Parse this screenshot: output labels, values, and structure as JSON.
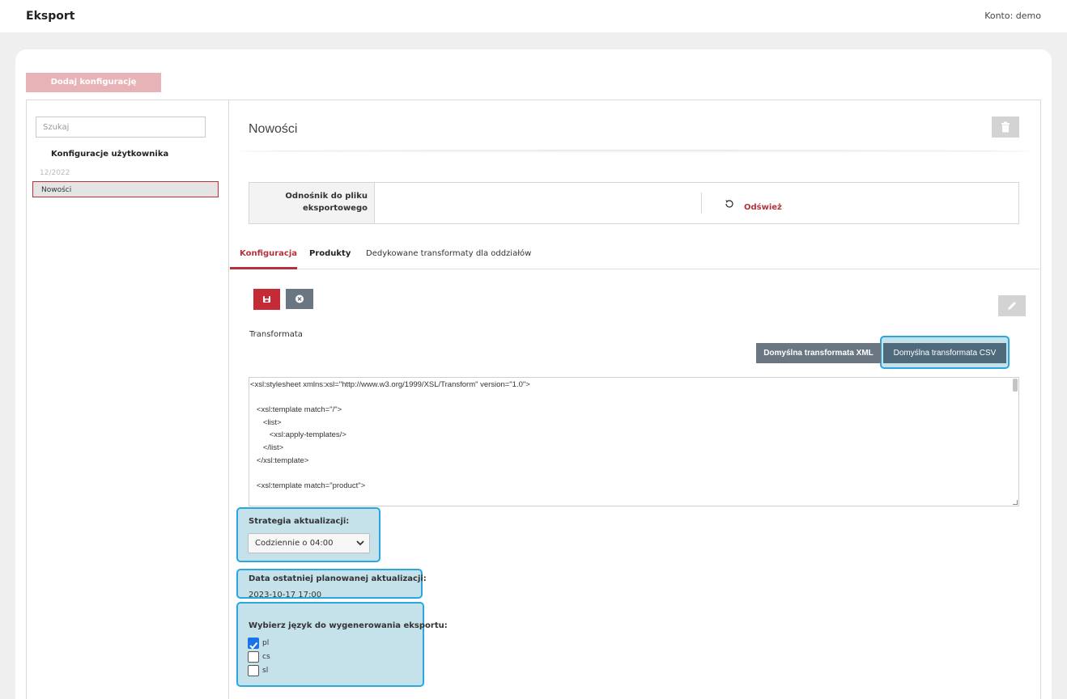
{
  "header": {
    "title": "Eksport",
    "account": "Konto: demo"
  },
  "add_config_button": "Dodaj konfigurację użytkownika",
  "sidebar": {
    "search_placeholder": "Szukaj",
    "group_title": "Konfiguracje użytkownika",
    "date": "12/2022",
    "items": [
      {
        "label": "Nowości"
      }
    ]
  },
  "main": {
    "title": "Nowości",
    "export_link": {
      "label": "Odnośnik do pliku eksportowego",
      "refresh_label": "Odśwież"
    },
    "tabs": [
      {
        "label": "Konfiguracja"
      },
      {
        "label": "Produkty"
      },
      {
        "label": "Dedykowane transformaty dla oddziałów"
      }
    ],
    "transform_label": "Transformata",
    "default_xml_button": "Domyślna transformata XML",
    "default_csv_button": "Domyślna transformata CSV",
    "code": "<xsl:stylesheet xmlns:xsl=\"http://www.w3.org/1999/XSL/Transform\" version=\"1.0\">\n\n   <xsl:template match=\"/\">\n      <list>\n         <xsl:apply-templates/>\n      </list>\n   </xsl:template>\n\n   <xsl:template match=\"product\">",
    "update_strategy": {
      "label": "Strategia aktualizacji:",
      "selected": "Codziennie o 04:00"
    },
    "last_update": {
      "label": "Data ostatniej planowanej aktualizacji:",
      "value": "2023-10-17 17:00"
    },
    "language": {
      "label": "Wybierz język do wygenerowania eksportu:",
      "options": [
        {
          "code": "pl",
          "checked": true
        },
        {
          "code": "cs",
          "checked": false
        },
        {
          "code": "sl",
          "checked": false
        }
      ]
    }
  },
  "colors": {
    "accent": "#c42b36",
    "highlight": "#27a8e0",
    "secondary_button": "#6b7683"
  }
}
